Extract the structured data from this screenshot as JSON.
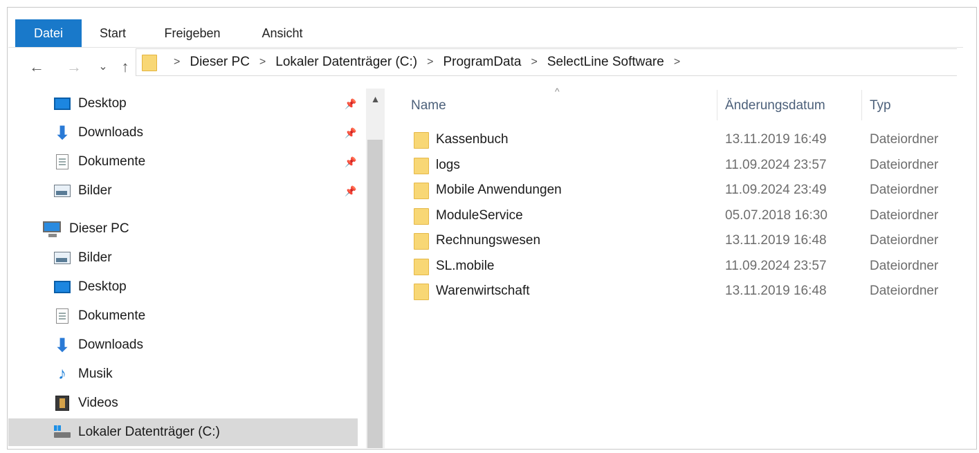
{
  "ribbon": {
    "tabs": [
      {
        "label": "Datei",
        "active": true
      },
      {
        "label": "Start"
      },
      {
        "label": "Freigeben"
      },
      {
        "label": "Ansicht"
      }
    ]
  },
  "navigation": {
    "back": "←",
    "forward": "→",
    "recent": "⌄",
    "up": "↑"
  },
  "address": {
    "crumbs": [
      "Dieser PC",
      "Lokaler Datenträger (C:)",
      "ProgramData",
      "SelectLine Software"
    ]
  },
  "nav_pane": {
    "quick_access": [
      {
        "label": "Desktop",
        "icon": "desktop-icon",
        "pinned": true
      },
      {
        "label": "Downloads",
        "icon": "download-icon",
        "pinned": true
      },
      {
        "label": "Dokumente",
        "icon": "documents-icon",
        "pinned": true
      },
      {
        "label": "Bilder",
        "icon": "pictures-icon",
        "pinned": true
      }
    ],
    "this_pc": {
      "label": "Dieser PC",
      "icon": "computer-icon"
    },
    "pc_items": [
      {
        "label": "Bilder",
        "icon": "pictures-icon"
      },
      {
        "label": "Desktop",
        "icon": "desktop-icon"
      },
      {
        "label": "Dokumente",
        "icon": "documents-icon"
      },
      {
        "label": "Downloads",
        "icon": "download-icon"
      },
      {
        "label": "Musik",
        "icon": "music-icon"
      },
      {
        "label": "Videos",
        "icon": "videos-icon"
      },
      {
        "label": "Lokaler Datenträger (C:)",
        "icon": "drive-icon",
        "selected": true
      }
    ]
  },
  "columns": {
    "name": "Name",
    "date": "Änderungsdatum",
    "type": "Typ"
  },
  "files": [
    {
      "name": "Kassenbuch",
      "date": "13.11.2019 16:49",
      "type": "Dateiordner"
    },
    {
      "name": "logs",
      "date": "11.09.2024 23:57",
      "type": "Dateiordner"
    },
    {
      "name": "Mobile Anwendungen",
      "date": "11.09.2024 23:49",
      "type": "Dateiordner"
    },
    {
      "name": "ModuleService",
      "date": "05.07.2018 16:30",
      "type": "Dateiordner"
    },
    {
      "name": "Rechnungswesen",
      "date": "13.11.2019 16:48",
      "type": "Dateiordner"
    },
    {
      "name": "SL.mobile",
      "date": "11.09.2024 23:57",
      "type": "Dateiordner"
    },
    {
      "name": "Warenwirtschaft",
      "date": "13.11.2019 16:48",
      "type": "Dateiordner"
    }
  ],
  "colors": {
    "file_tab": "#1979ca",
    "folder": "#f8d775",
    "selected_nav": "#d9d9d9"
  }
}
